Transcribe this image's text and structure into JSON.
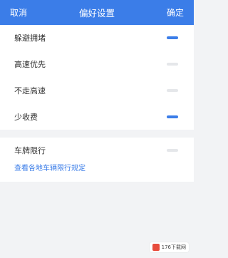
{
  "header": {
    "cancel_label": "取消",
    "title": "偏好设置",
    "confirm_label": "确定",
    "bg_color": "#3b7de8"
  },
  "preferences": [
    {
      "label": "躲避拥堵",
      "enabled": true
    },
    {
      "label": "高速优先",
      "enabled": false
    },
    {
      "label": "不走高速",
      "enabled": false
    },
    {
      "label": "少收费",
      "enabled": true
    }
  ],
  "plate_restriction": {
    "label": "车牌限行",
    "enabled": false,
    "link_text": "查看各地车辆限行规定"
  },
  "watermark": {
    "text": "176下载网"
  },
  "colors": {
    "accent": "#3b7de8",
    "toggle_off": "#e5e7ea"
  }
}
